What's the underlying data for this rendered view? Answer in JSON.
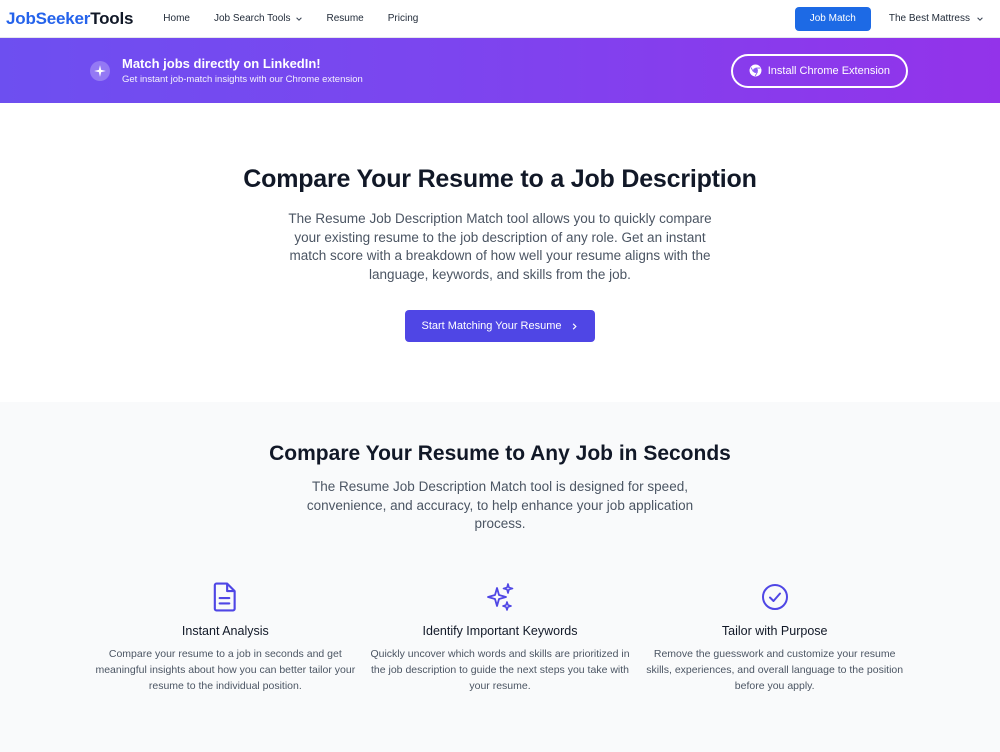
{
  "nav": {
    "logo_part1": "JobSeeker",
    "logo_part2": "Tools",
    "links": [
      "Home",
      "Job Search Tools",
      "Resume",
      "Pricing"
    ],
    "job_match_button": "Job Match",
    "account_label": "The Best Mattress"
  },
  "banner": {
    "title": "Match jobs directly on LinkedIn!",
    "subtitle": "Get instant job-match insights with our Chrome extension",
    "button_label": "Install Chrome Extension"
  },
  "hero": {
    "title": "Compare Your Resume to a Job Description",
    "description": "The Resume Job Description Match tool allows you to quickly compare your existing resume to the job description of any role. Get an instant match score with a breakdown of how well your resume aligns with the language, keywords, and skills from the job.",
    "cta_label": "Start Matching Your Resume"
  },
  "features": {
    "title": "Compare Your Resume to Any Job in Seconds",
    "subtitle": "The Resume Job Description Match tool is designed for speed, convenience, and accuracy, to help enhance your job application process.",
    "items": [
      {
        "icon": "document-icon",
        "title": "Instant Analysis",
        "text": "Compare your resume to a job in seconds and get meaningful insights about how you can better tailor your resume to the individual position."
      },
      {
        "icon": "sparkles-icon",
        "title": "Identify Important Keywords",
        "text": "Quickly uncover which words and skills are prioritized in the job description to guide the next steps you take with your resume."
      },
      {
        "icon": "check-circle-icon",
        "title": "Tailor with Purpose",
        "text": "Remove the guesswork and customize your resume skills, experiences, and overall language to the position before you apply."
      }
    ]
  },
  "colors": {
    "brand_blue": "#2563eb",
    "indigo": "#4f46e5",
    "banner_start": "#6d4ff0",
    "banner_end": "#9333ea"
  }
}
